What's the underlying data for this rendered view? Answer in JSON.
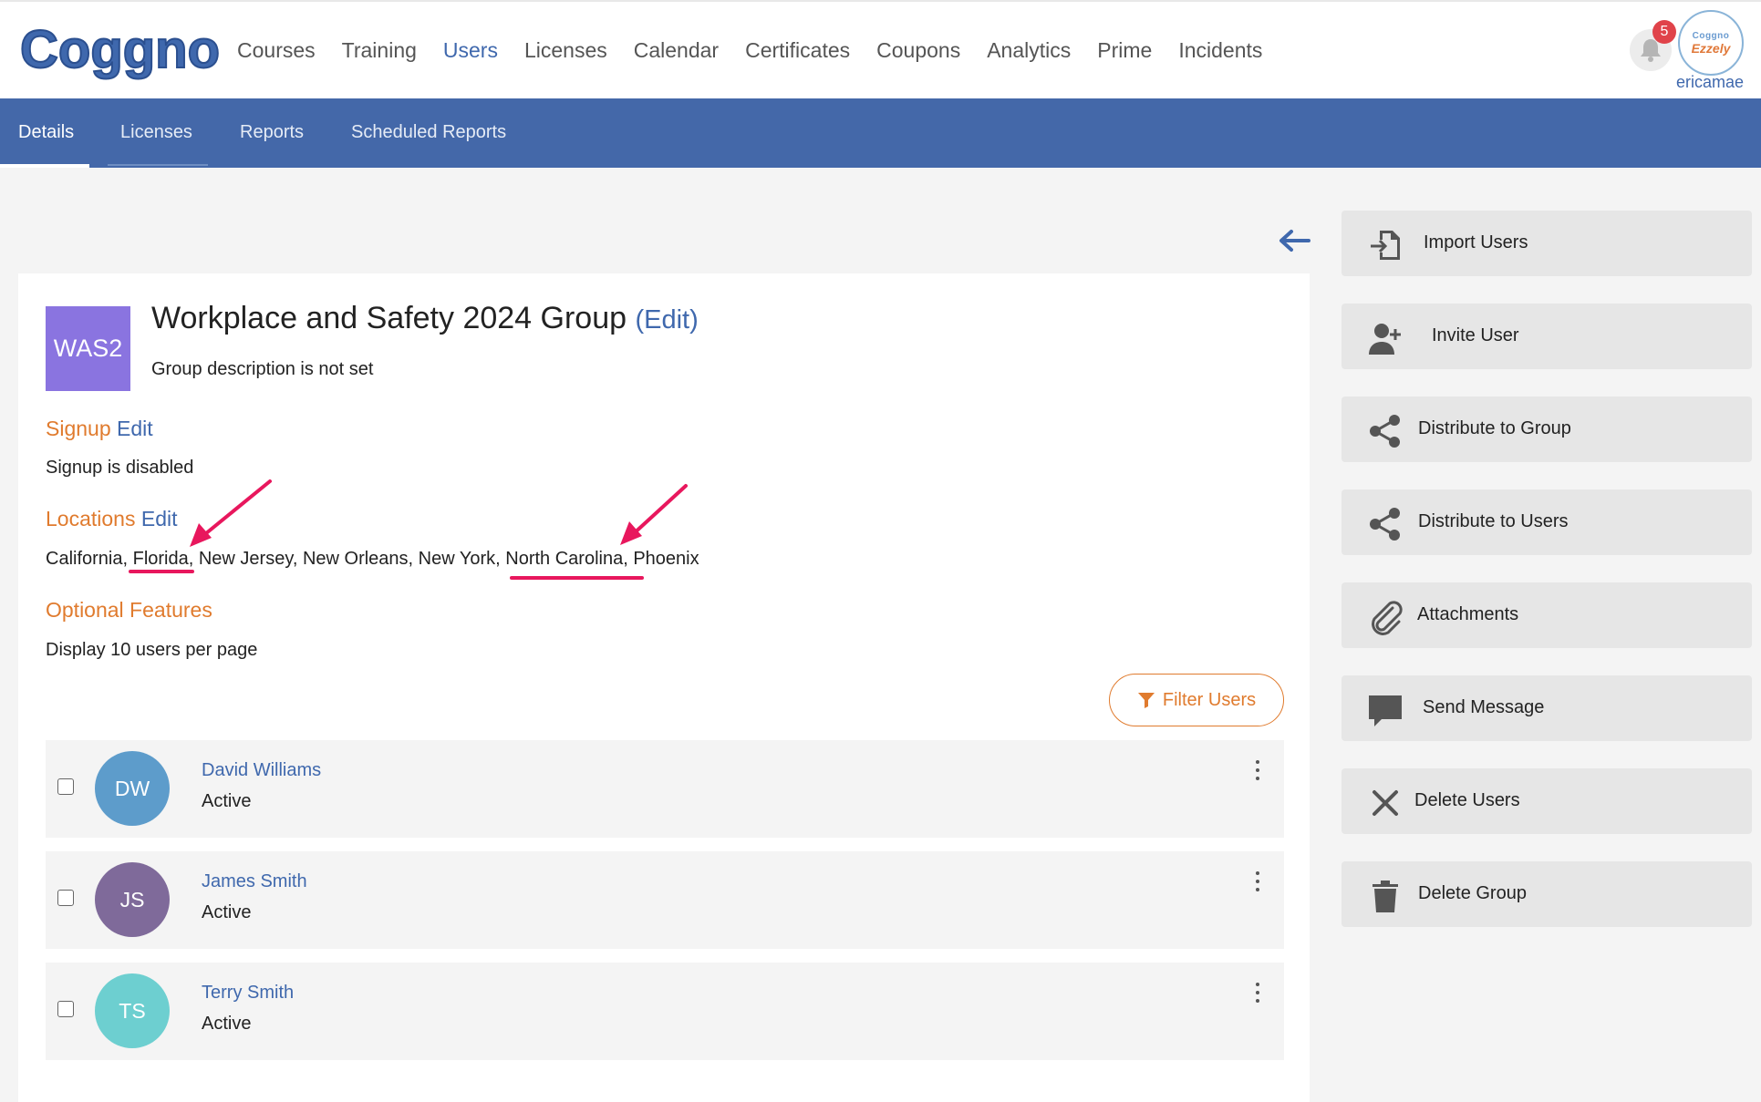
{
  "brand": {
    "logo_text": "Coggno",
    "accent": "#3f68ad",
    "orange": "#e07b2e"
  },
  "nav": {
    "items": [
      "Courses",
      "Training",
      "Users",
      "Licenses",
      "Calendar",
      "Certificates",
      "Coupons",
      "Analytics",
      "Prime",
      "Incidents"
    ],
    "active": "Users"
  },
  "notifications": {
    "count": "5",
    "icon": "bell-icon"
  },
  "account": {
    "avatar_line1": "Coggno",
    "avatar_line2": "Ezzely",
    "username": "ericamae"
  },
  "subnav": {
    "tabs": [
      "Details",
      "Licenses",
      "Reports",
      "Scheduled Reports"
    ],
    "active": "Details"
  },
  "group": {
    "tile": "WAS2",
    "tile_color": "#8a74e0",
    "title": "Workplace and Safety 2024 Group",
    "edit": "(Edit)",
    "description": "Group description is not set"
  },
  "signup": {
    "heading": "Signup",
    "edit": "Edit",
    "text": "Signup is disabled"
  },
  "locations": {
    "heading": "Locations",
    "edit": "Edit",
    "text": "California, Florida, New Jersey, New Orleans, New York, North Carolina, Phoenix"
  },
  "optional": {
    "heading": "Optional Features",
    "text": "Display 10 users per page"
  },
  "filter": {
    "label": "Filter Users",
    "icon": "filter-icon"
  },
  "users": [
    {
      "initials": "DW",
      "name": "David Williams",
      "status": "Active",
      "color": "#5d9ccb"
    },
    {
      "initials": "JS",
      "name": "James Smith",
      "status": "Active",
      "color": "#7f6a9a"
    },
    {
      "initials": "TS",
      "name": "Terry Smith",
      "status": "Active",
      "color": "#6dcfd0"
    }
  ],
  "actions": [
    {
      "label": "Import Users",
      "icon": "import-icon"
    },
    {
      "label": "Invite User",
      "icon": "add-user-icon"
    },
    {
      "label": "Distribute to Group",
      "icon": "share-icon"
    },
    {
      "label": "Distribute to Users",
      "icon": "share-icon"
    },
    {
      "label": "Attachments",
      "icon": "paperclip-icon"
    },
    {
      "label": "Send Message",
      "icon": "message-icon"
    },
    {
      "label": "Delete Users",
      "icon": "close-icon"
    },
    {
      "label": "Delete Group",
      "icon": "trash-icon"
    }
  ]
}
